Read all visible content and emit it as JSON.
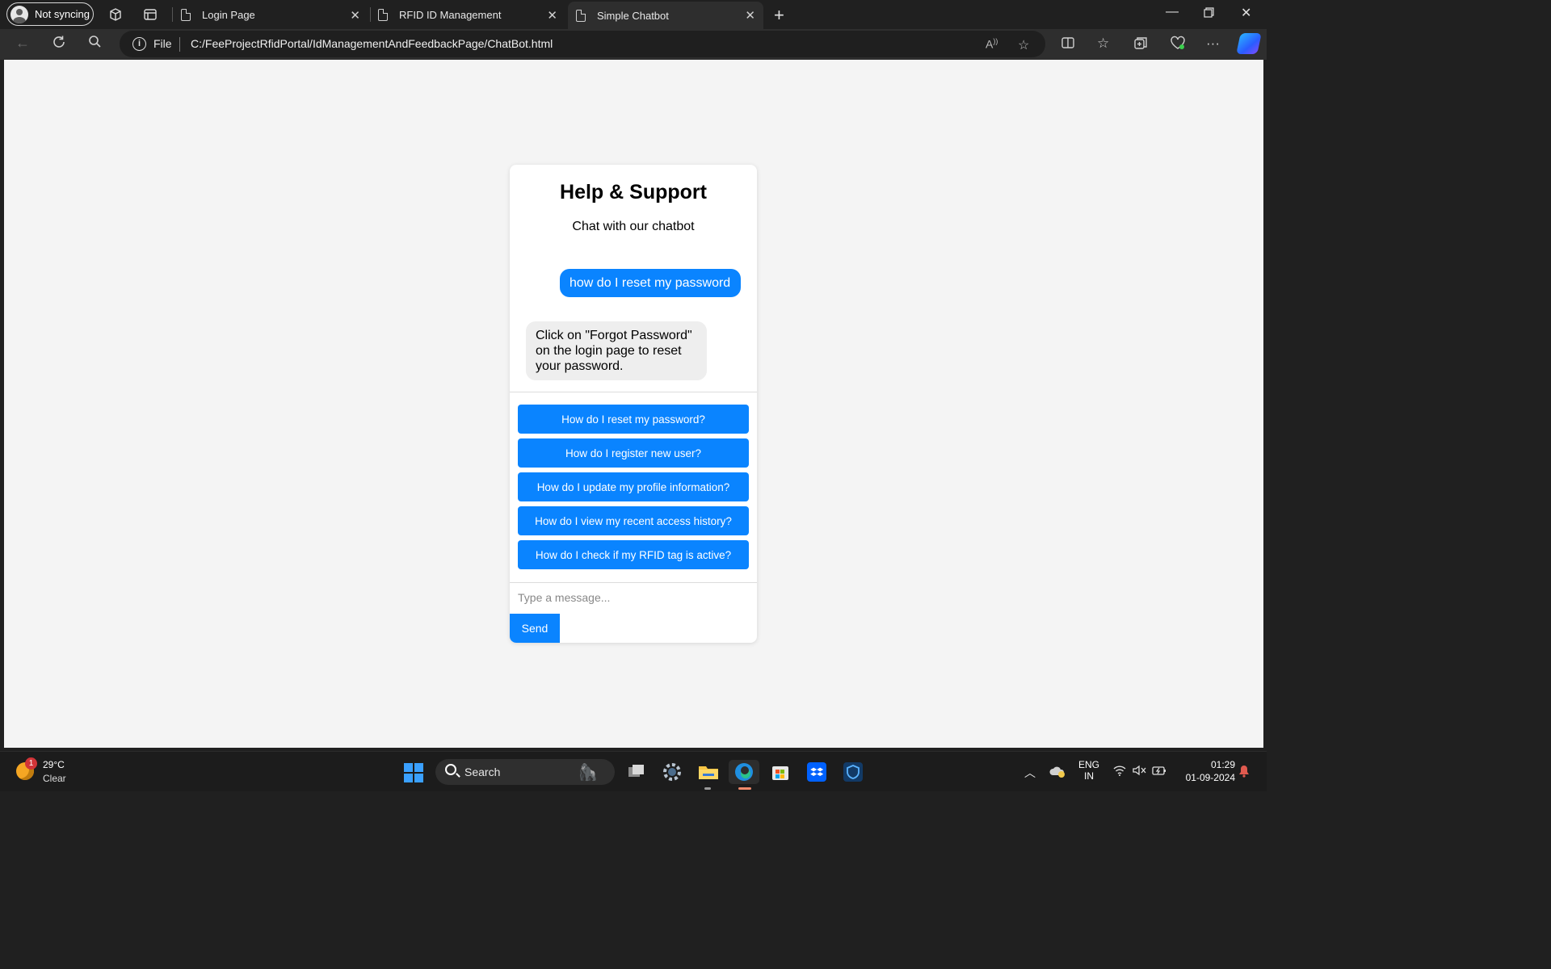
{
  "browser": {
    "profile_label": "Not syncing",
    "tabs": [
      {
        "title": "Login Page"
      },
      {
        "title": "RFID ID Management"
      },
      {
        "title": "Simple Chatbot"
      }
    ],
    "address": {
      "scheme_label": "File",
      "url": "C:/FeeProjectRfidPortal/IdManagementAndFeedbackPage/ChatBot.html"
    }
  },
  "chat": {
    "title": "Help & Support",
    "subtitle": "Chat with our chatbot",
    "messages": [
      {
        "role": "user",
        "text": "how do I reset my password"
      },
      {
        "role": "bot",
        "text": "Click on \"Forgot Password\" on the login page to reset your password."
      }
    ],
    "quick_questions": [
      "How do I reset my password?",
      "How do I register new user?",
      "How do I update my profile information?",
      "How do I view my recent access history?",
      "How do I check if my RFID tag is active?"
    ],
    "input_placeholder": "Type a message...",
    "send_label": "Send",
    "accent_color": "#0a84ff"
  },
  "taskbar": {
    "weather": {
      "temp": "29°C",
      "condition": "Clear",
      "badge": "1"
    },
    "search_label": "Search",
    "language": {
      "line1": "ENG",
      "line2": "IN"
    },
    "clock": {
      "time": "01:29",
      "date": "01-09-2024"
    }
  }
}
